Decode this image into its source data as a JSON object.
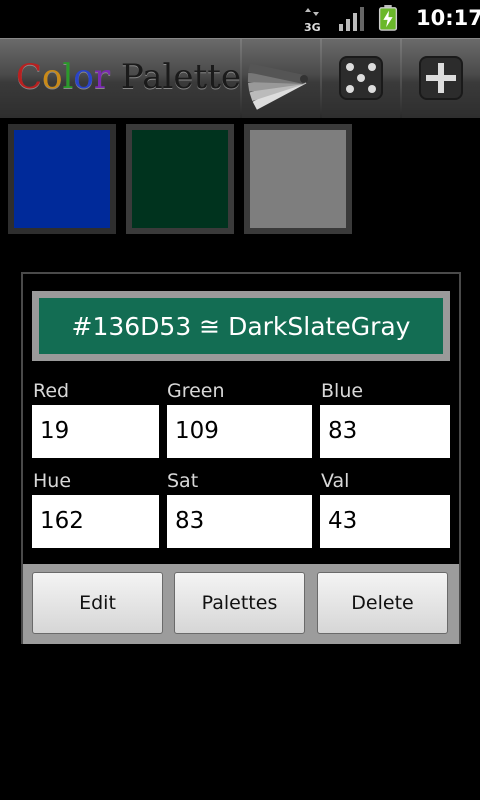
{
  "status_bar": {
    "time": "10:17",
    "network_label": "3G"
  },
  "title_bar": {
    "title_letters": [
      "C",
      "o",
      "l",
      "o",
      "r"
    ],
    "title_letter_colors": [
      "#b82020",
      "#c98a18",
      "#2a9a2a",
      "#2a44c8",
      "#7a2ab0"
    ],
    "title_rest": " Palette"
  },
  "swatches": [
    {
      "color": "#002a9a",
      "border": "#2e2e2e"
    },
    {
      "color": "#00331e",
      "border": "#3a3a3a"
    },
    {
      "color": "#7e7e7e",
      "border": "#3a3a3a"
    }
  ],
  "selected_color": {
    "hex_label": "#136D53 ≅ DarkSlateGray",
    "fill": "#136D53",
    "red_label": "Red",
    "red": "19",
    "green_label": "Green",
    "green": "109",
    "blue_label": "Blue",
    "blue": "83",
    "hue_label": "Hue",
    "hue": "162",
    "sat_label": "Sat",
    "sat": "83",
    "val_label": "Val",
    "val": "43"
  },
  "buttons": {
    "edit": "Edit",
    "palettes": "Palettes",
    "delete": "Delete"
  }
}
